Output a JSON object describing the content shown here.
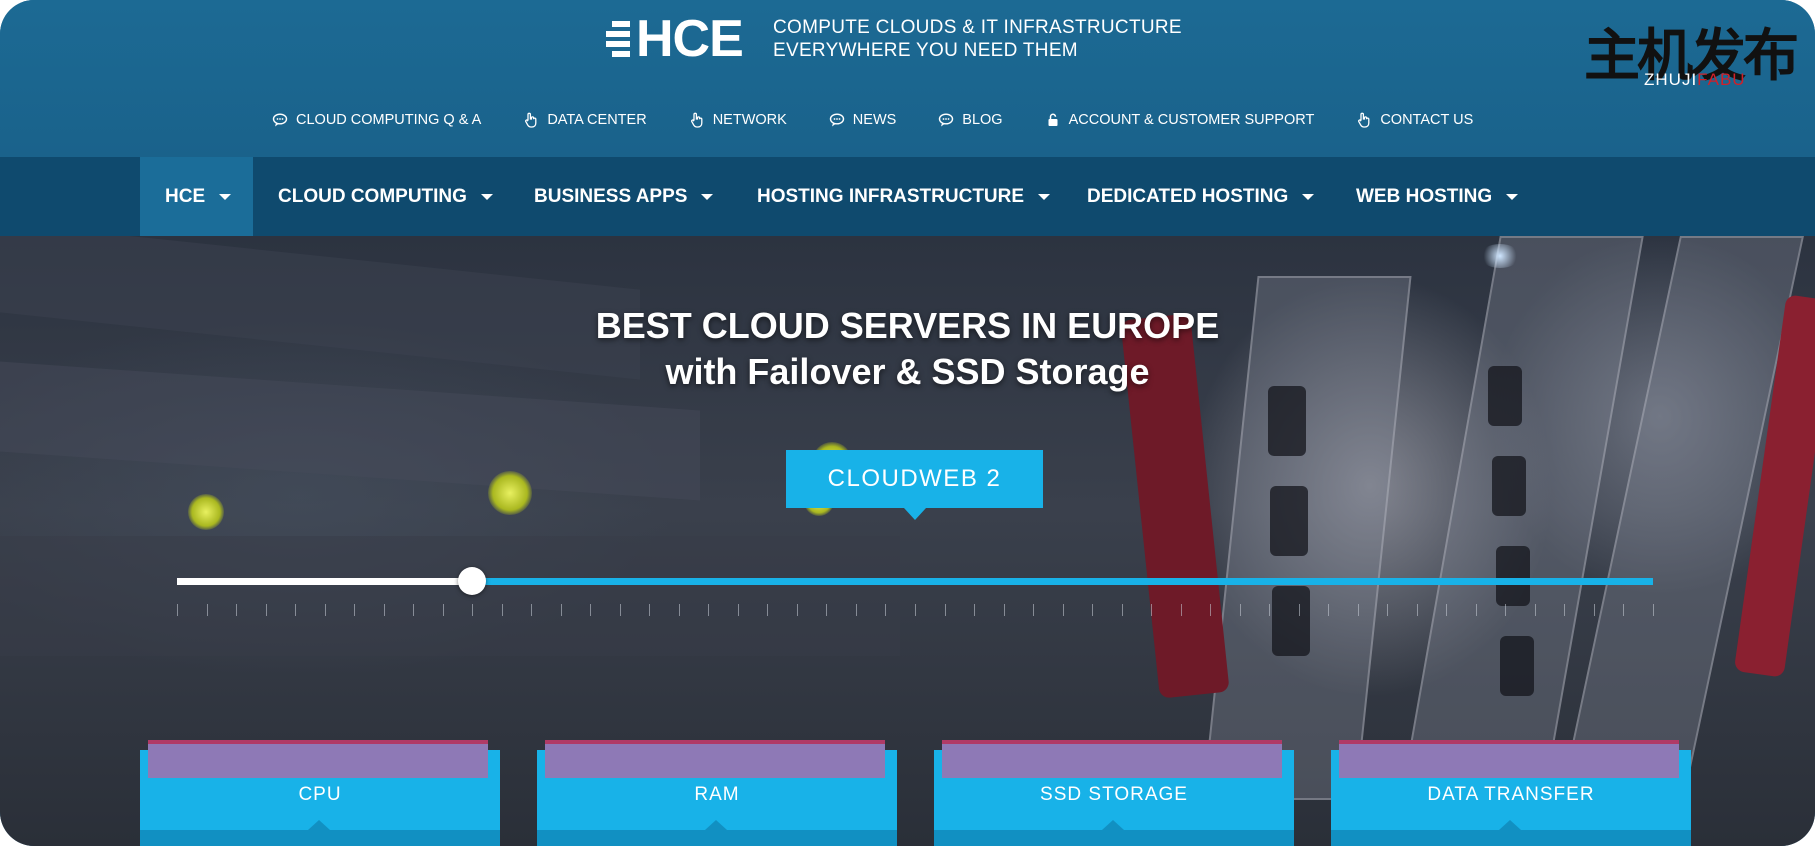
{
  "brand": {
    "logo_text": "HCE",
    "tagline_line1": "COMPUTE CLOUDS & IT INFRASTRUCTURE",
    "tagline_line2": "EVERYWHERE YOU NEED THEM"
  },
  "watermark": {
    "cn_text": "主机发布",
    "en_part1": "ZHUJI",
    "en_part2": "FABU"
  },
  "top_nav": [
    {
      "label": "CLOUD COMPUTING Q & A",
      "icon": "chat-bubble-icon"
    },
    {
      "label": "DATA CENTER",
      "icon": "hand-pointer-icon"
    },
    {
      "label": "NETWORK",
      "icon": "hand-pointer-icon"
    },
    {
      "label": "NEWS",
      "icon": "chat-bubble-icon"
    },
    {
      "label": "BLOG",
      "icon": "chat-bubble-icon"
    },
    {
      "label": "ACCOUNT & CUSTOMER SUPPORT",
      "icon": "lock-icon"
    },
    {
      "label": "CONTACT US",
      "icon": "hand-pointer-icon"
    }
  ],
  "main_nav": [
    {
      "label": "HCE",
      "active": true
    },
    {
      "label": "CLOUD COMPUTING",
      "active": false
    },
    {
      "label": "BUSINESS APPS",
      "active": false
    },
    {
      "label": "HOSTING INFRASTRUCTURE",
      "active": false
    },
    {
      "label": "DEDICATED HOSTING",
      "active": false
    },
    {
      "label": "WEB HOSTING",
      "active": false
    }
  ],
  "hero": {
    "title_line1": "BEST CLOUD SERVERS IN EUROPE",
    "title_line2": "with Failover & SSD Storage",
    "plan_label": "CLOUDWEB 2",
    "slider_value": 0.2
  },
  "cards": [
    {
      "label": "CPU"
    },
    {
      "label": "RAM"
    },
    {
      "label": "SSD STORAGE"
    },
    {
      "label": "DATA TRANSFER"
    }
  ],
  "colors": {
    "header_bg": "#1b6690",
    "main_nav_bg": "#0f4a6e",
    "accent": "#18b2e8",
    "card_bar": "#8e79b6"
  }
}
